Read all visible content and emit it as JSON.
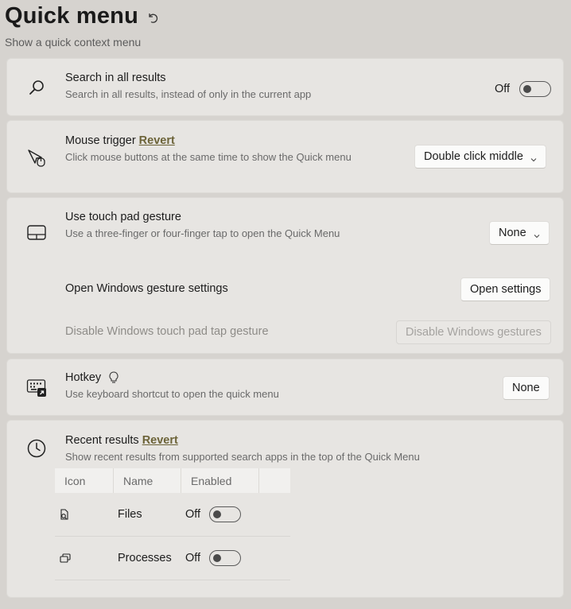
{
  "header": {
    "title": "Quick menu",
    "subtitle": "Show a quick context menu"
  },
  "search_all": {
    "title": "Search in all results",
    "description": "Search in all results, instead of only in the current app",
    "toggle_label": "Off",
    "toggle_on": false,
    "icon": "search-icon"
  },
  "mouse_trigger": {
    "title": "Mouse trigger",
    "revert_label": "Revert",
    "description": "Click mouse buttons at the same time to show the Quick menu",
    "dropdown_value": "Double click middle",
    "icon": "mouse-pointer-icon"
  },
  "touchpad": {
    "title": "Use touch pad gesture",
    "description": "Use a three-finger or four-finger tap to open the Quick Menu",
    "dropdown_value": "None",
    "open_settings_title": "Open Windows gesture settings",
    "open_settings_button": "Open settings",
    "disable_title": "Disable Windows touch pad tap gesture",
    "disable_button": "Disable Windows gestures",
    "icon": "touchpad-icon"
  },
  "hotkey": {
    "title": "Hotkey",
    "description": "Use keyboard shortcut to open the quick menu",
    "button_label": "None",
    "icon": "keyboard-shortcut-icon",
    "hint_icon": "lightbulb-icon"
  },
  "recent_results": {
    "title": "Recent results",
    "revert_label": "Revert",
    "description": "Show recent results from supported search apps in the top of the Quick Menu",
    "icon": "clock-icon",
    "table": {
      "columns": [
        "Icon",
        "Name",
        "Enabled",
        ""
      ],
      "rows": [
        {
          "icon": "files-icon",
          "name": "Files",
          "toggle_label": "Off",
          "enabled": false
        },
        {
          "icon": "processes-icon",
          "name": "Processes",
          "toggle_label": "Off",
          "enabled": false
        }
      ]
    }
  }
}
